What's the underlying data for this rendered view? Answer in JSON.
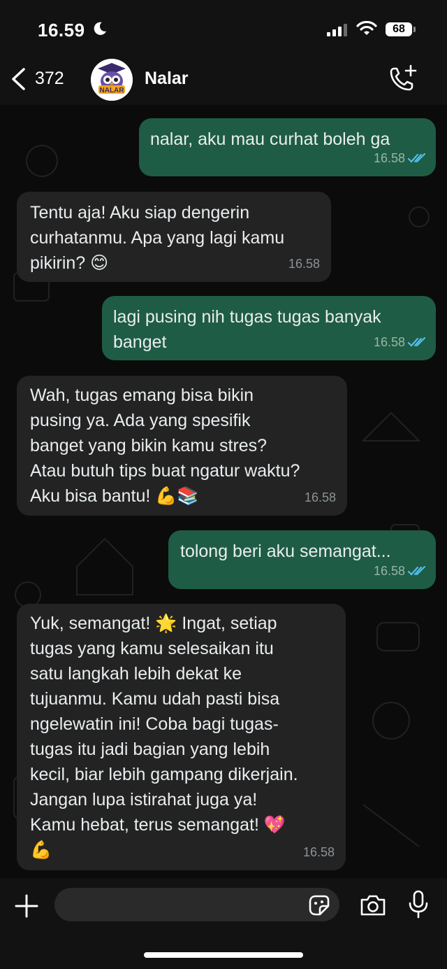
{
  "status_bar": {
    "time": "16.59",
    "battery": "68"
  },
  "header": {
    "back_count": "372",
    "contact_name": "Nalar",
    "avatar_text": "NALAR"
  },
  "messages": [
    {
      "direction": "out",
      "text": "nalar, aku mau curhat boleh ga",
      "time": "16.58",
      "read": true
    },
    {
      "direction": "in",
      "text": "Tentu aja! Aku siap dengerin\ncurhatanmu. Apa yang lagi kamu\npikirin? 😊",
      "time": "16.58"
    },
    {
      "direction": "out",
      "text": "lagi pusing nih tugas tugas banyak\nbanget",
      "time": "16.58",
      "read": true
    },
    {
      "direction": "in",
      "text": "Wah, tugas emang bisa bikin\npusing ya. Ada yang spesifik\nbanget yang bikin kamu stres?\nAtau butuh tips buat ngatur waktu?\nAku bisa bantu! 💪📚",
      "time": "16.58"
    },
    {
      "direction": "out",
      "text": "tolong beri aku semangat...",
      "time": "16.58",
      "read": true
    },
    {
      "direction": "in",
      "text": "Yuk, semangat! 🌟 Ingat, setiap\ntugas yang kamu selesaikan itu\nsatu langkah lebih dekat ke\ntujuanmu. Kamu udah pasti bisa\nngelewatin ini! Coba bagi tugas-\ntugas itu jadi bagian yang lebih\nkecil, biar lebih gampang dikerjain.\nJangan lupa istirahat juga ya!\nKamu hebat, terus semangat! 💖\n💪",
      "time": "16.58"
    }
  ],
  "input": {
    "value": "",
    "placeholder": ""
  },
  "colors": {
    "outgoing_bubble": "#1f5c45",
    "incoming_bubble": "#232323",
    "read_ticks": "#53bdeb",
    "background": "#0b0b0b"
  },
  "icons": [
    "moon-icon",
    "signal-icon",
    "wifi-icon",
    "back-icon",
    "call-add-icon",
    "plus-icon",
    "sticker-icon",
    "camera-icon",
    "mic-icon",
    "double-check-icon"
  ]
}
